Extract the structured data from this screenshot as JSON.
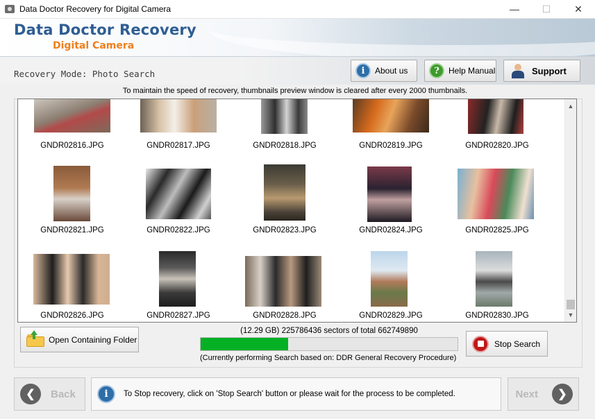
{
  "window": {
    "title": "Data Doctor Recovery for Digital Camera",
    "minimize_glyph": "—",
    "maximize_glyph": "☐",
    "close_glyph": "✕"
  },
  "banner": {
    "brand": "Data Doctor Recovery",
    "product": "Digital Camera"
  },
  "mode": {
    "label": "Recovery Mode: Photo Search"
  },
  "toolbar": {
    "about_label": "About us",
    "about_icon": "info-icon",
    "help_label": "Help Manual",
    "help_icon": "question-icon",
    "support_label": "Support",
    "support_icon": "support-agent-icon"
  },
  "notice": "To maintain the speed of recovery, thumbnails preview window is cleared after every 2000 thumbnails.",
  "thumbnails": [
    {
      "name": "GNDR02816.JPG"
    },
    {
      "name": "GNDR02817.JPG"
    },
    {
      "name": "GNDR02818.JPG"
    },
    {
      "name": "GNDR02819.JPG"
    },
    {
      "name": "GNDR02820.JPG"
    },
    {
      "name": "GNDR02821.JPG"
    },
    {
      "name": "GNDR02822.JPG"
    },
    {
      "name": "GNDR02823.JPG"
    },
    {
      "name": "GNDR02824.JPG"
    },
    {
      "name": "GNDR02825.JPG"
    },
    {
      "name": "GNDR02826.JPG"
    },
    {
      "name": "GNDR02827.JPG"
    },
    {
      "name": "GNDR02828.JPG"
    },
    {
      "name": "GNDR02829.JPG"
    },
    {
      "name": "GNDR02830.JPG"
    }
  ],
  "folder_button": {
    "label": "Open Containing Folder"
  },
  "progress": {
    "sectors_text": "(12.29 GB) 225786436  sectors  of  total 662749890",
    "fraction": 0.34,
    "procedure_text": "(Currently performing Search based on:  DDR General Recovery Procedure)",
    "fill_color": "#06b025"
  },
  "stop_button": {
    "label": "Stop Search"
  },
  "nav": {
    "back_label": "Back",
    "next_label": "Next"
  },
  "status": {
    "message": "To Stop recovery, click on 'Stop Search' button or please wait for the process to be completed."
  },
  "colors": {
    "brand_blue": "#2f5e93",
    "product_orange": "#f07f1b"
  }
}
